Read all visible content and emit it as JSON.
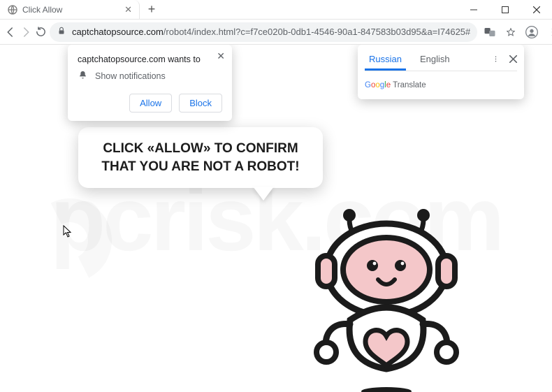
{
  "tab": {
    "title": "Click Allow"
  },
  "url": {
    "host": "captchatopsource.com",
    "path": "/robot4/index.html?c=f7ce020b-0db1-4546-90a1-847583b03d95&a=I74625#"
  },
  "notification": {
    "title": "captchatopsource.com wants to",
    "permission_label": "Show notifications",
    "allow": "Allow",
    "block": "Block"
  },
  "translate": {
    "tab_active": "Russian",
    "tab_other": "English",
    "brand_word": "Translate"
  },
  "page": {
    "bubble_text": "CLICK «ALLOW» TO CONFIRM THAT YOU ARE NOT A ROBOT!"
  },
  "watermark": {
    "text": "pcrisk.com"
  },
  "icons": {
    "globe": "globe-icon",
    "plus": "plus-icon",
    "min": "window-minimize-icon",
    "max": "window-maximize-icon",
    "close": "window-close-icon",
    "back": "nav-back-icon",
    "fwd": "nav-forward-icon",
    "reload": "reload-icon",
    "lock": "lock-icon",
    "translate": "translate-icon",
    "star": "star-icon",
    "avatar": "avatar-icon",
    "menu": "menu-icon",
    "bell": "bell-icon",
    "x": "close-icon",
    "kebab": "kebab-icon"
  }
}
